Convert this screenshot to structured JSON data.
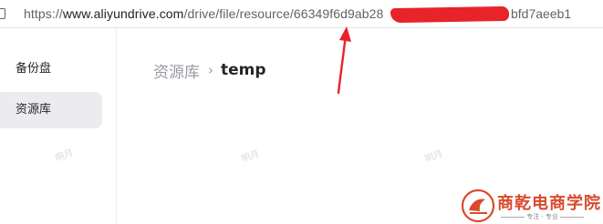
{
  "address_bar": {
    "url_prefix": "https://",
    "url_host": "www.aliyundrive.com",
    "url_path": "/drive/file/resource/66349f6d9ab28",
    "url_tail": "bfd7aeeb1"
  },
  "sidebar": {
    "items": [
      {
        "label": "备份盘",
        "active": false
      },
      {
        "label": "资源库",
        "active": true
      }
    ]
  },
  "breadcrumb": {
    "parent": "资源库",
    "separator": "›",
    "current": "temp"
  },
  "watermark": "明月",
  "logo": {
    "title": "商乾电商学院",
    "slogan": "专注 · 专业"
  },
  "colors": {
    "annotation": "#e8232a",
    "logo": "#d94a2c"
  }
}
